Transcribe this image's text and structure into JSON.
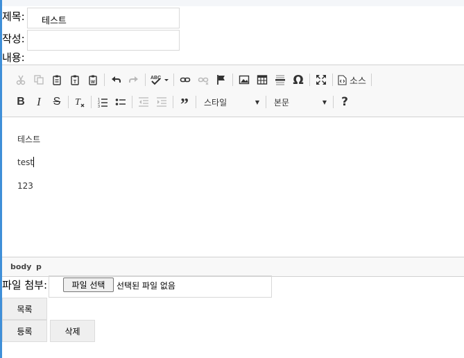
{
  "form": {
    "title_label": "제목:",
    "title_value": "테스트",
    "author_label": "작성:",
    "author_value": "",
    "content_label": "내용:",
    "attach_label": "파일 첨부:",
    "file_button": "파일 선택",
    "file_status": "선택된 파일 없음"
  },
  "toolbar": {
    "source_label": "소스",
    "style_combo": "스타일",
    "format_combo": "본문"
  },
  "editor": {
    "paragraphs": [
      "테스트",
      "test",
      "123"
    ],
    "path": [
      "body",
      "p"
    ]
  },
  "buttons": {
    "list": "목록",
    "register": "등록",
    "delete": "삭제"
  },
  "colors": {
    "accent": "#3f8fd8"
  }
}
